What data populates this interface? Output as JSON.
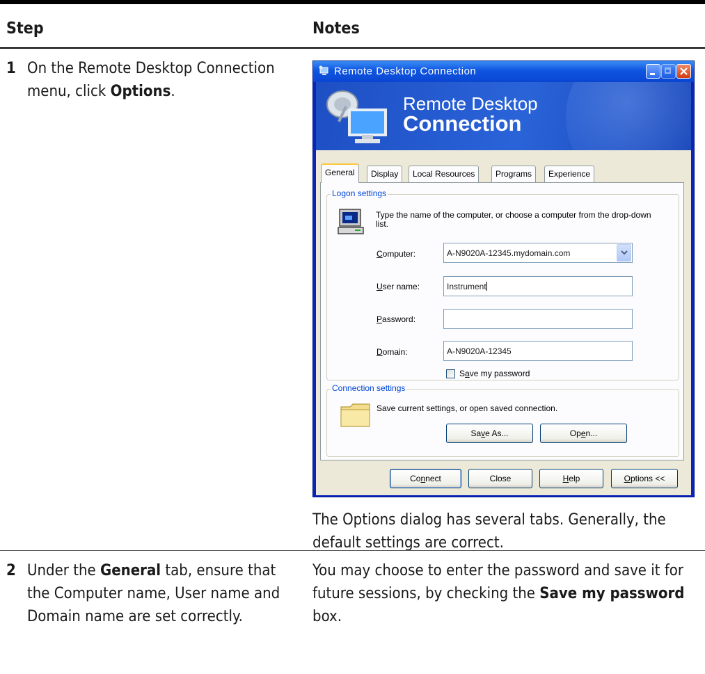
{
  "table": {
    "headers": {
      "step": "Step",
      "notes": "Notes"
    },
    "rows": [
      {
        "num": "1",
        "step_before": "On the Remote Desktop Connection menu, click ",
        "step_bold": "Options",
        "step_after": ".",
        "note": "The Options dialog has several tabs. Generally, the default settings are correct."
      },
      {
        "num": "2",
        "step_before": "Under the ",
        "step_bold": "General",
        "step_after": " tab, ensure that the Computer name, User name and Domain name are set correctly.",
        "note_before": "You may choose to enter the password and save it for future sessions, by checking the ",
        "note_bold": "Save my password",
        "note_after": " box."
      }
    ]
  },
  "dialog": {
    "title": "Remote Desktop Connection",
    "banner_line1": "Remote Desktop",
    "banner_line2": "Connection",
    "tabs": [
      "General",
      "Display",
      "Local Resources",
      "Programs",
      "Experience"
    ],
    "logon_group": "Logon settings",
    "logon_hint": "Type the name of the computer, or choose a computer from the drop-down list.",
    "computer_label": "Computer:",
    "computer_value": "A-N9020A-12345.mydomain.com",
    "username_label": "User name:",
    "username_value": "Instrument",
    "password_label": "Password:",
    "password_value": "",
    "domain_label": "Domain:",
    "domain_value": "A-N9020A-12345",
    "save_password_label": "Save my password",
    "save_password_checked": false,
    "connection_group": "Connection settings",
    "connection_hint": "Save current settings, or open saved connection.",
    "save_as_button": "Save As...",
    "open_button": "Open...",
    "connect_button": "Connect",
    "close_button": "Close",
    "help_button": "Help",
    "options_button": "Options <<"
  }
}
